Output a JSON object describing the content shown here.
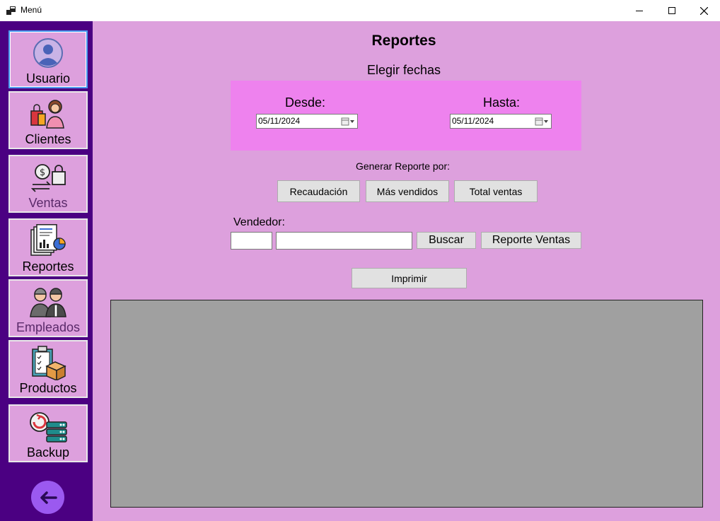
{
  "window": {
    "title": "Menú"
  },
  "sidebar": {
    "items": [
      {
        "label": "Usuario",
        "icon": "user-avatar-icon"
      },
      {
        "label": "Clientes",
        "icon": "clients-icon"
      },
      {
        "label": "Ventas",
        "icon": "sales-icon"
      },
      {
        "label": "Reportes",
        "icon": "reports-icon"
      },
      {
        "label": "Empleados",
        "icon": "employees-icon"
      },
      {
        "label": "Productos",
        "icon": "products-icon"
      },
      {
        "label": "Backup",
        "icon": "backup-icon"
      }
    ],
    "back_icon": "back-arrow-icon"
  },
  "main": {
    "title": "Reportes",
    "subtitle": "Elegir fechas",
    "from_label": "Desde:",
    "from_value": "05/11/2024",
    "to_label": "Hasta:",
    "to_value": "05/11/2024",
    "generate_label": "Generar Reporte por:",
    "buttons": {
      "recaudacion": "Recaudación",
      "mas_vendidos": "Más vendidos",
      "total_ventas": "Total ventas",
      "buscar": "Buscar",
      "reporte_ventas": "Reporte Ventas",
      "imprimir": "Imprimir"
    },
    "vendor_label": "Vendedor:",
    "vendor_id_value": "",
    "vendor_name_value": ""
  },
  "colors": {
    "sidebar_bg": "#4b0082",
    "main_bg": "#dda0dd",
    "date_panel_bg": "#ee82ee",
    "nav_button_bg": "#dda0dd",
    "back_button": "#9b59f0",
    "report_area": "#a0a0a0"
  }
}
